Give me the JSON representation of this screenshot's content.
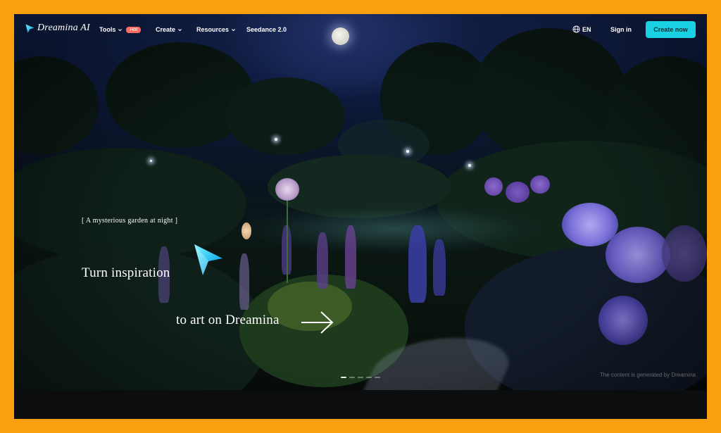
{
  "brand": {
    "name": "Dreamina AI"
  },
  "nav": {
    "tools": {
      "label": "Tools",
      "badge": "Hot"
    },
    "create": {
      "label": "Create"
    },
    "resources": {
      "label": "Resources"
    },
    "seedance": {
      "label": "Seedance 2.0"
    },
    "language": "EN",
    "sign_in": "Sign in",
    "create_now": "Create now"
  },
  "hero": {
    "caption": "[ A mysterious garden at night ]",
    "headline_line1": "Turn inspiration",
    "headline_line2": "to art on Dreamina",
    "credit": "The content is generated by Dreamina",
    "carousel": {
      "count": 5,
      "active_index": 0
    }
  },
  "colors": {
    "frame_border": "#F99F10",
    "accent_cyan": "#1AD1E4",
    "hot_badge": "#FF6A5C"
  },
  "icons": [
    "dreamina-logo-icon",
    "chevron-down-icon",
    "globe-icon",
    "dreamina-star-icon",
    "arrow-right-icon"
  ]
}
